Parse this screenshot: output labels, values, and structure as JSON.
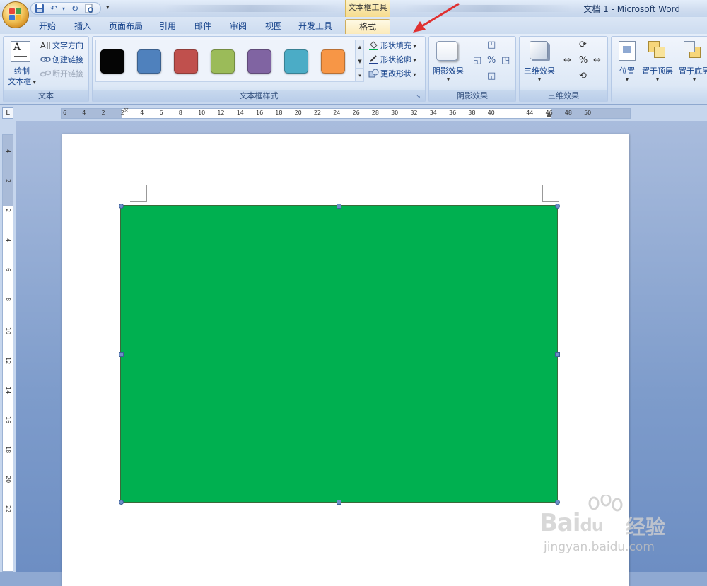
{
  "window": {
    "title": "文档 1 - Microsoft Word",
    "context_tool_title": "文本框工具"
  },
  "tabs": [
    {
      "label": "开始",
      "active": false
    },
    {
      "label": "插入",
      "active": false
    },
    {
      "label": "页面布局",
      "active": false
    },
    {
      "label": "引用",
      "active": false
    },
    {
      "label": "邮件",
      "active": false
    },
    {
      "label": "审阅",
      "active": false
    },
    {
      "label": "视图",
      "active": false
    },
    {
      "label": "开发工具",
      "active": false
    },
    {
      "label": "格式",
      "active": true
    }
  ],
  "ribbon": {
    "text_group": {
      "label": "文本",
      "draw_textbox_line1": "绘制",
      "draw_textbox_line2": "文本框",
      "text_direction": "文字方向",
      "create_link": "创建链接",
      "break_link": "断开链接"
    },
    "textbox_styles": {
      "label": "文本框样式",
      "swatches": [
        "#050505",
        "#4f81bd",
        "#c0504d",
        "#9bbb59",
        "#8064a2",
        "#4bacc6",
        "#f79646"
      ],
      "shape_fill": "形状填充",
      "shape_outline": "形状轮廓",
      "change_shape": "更改形状"
    },
    "shadow_effects": {
      "label": "阴影效果",
      "button": "阴影效果"
    },
    "effects_3d": {
      "label": "三维效果",
      "button": "三维效果"
    },
    "arrange": {
      "position": "位置",
      "bring_to_front": "置于顶层",
      "send_to_back": "置于底层"
    }
  },
  "ruler": {
    "horizontal_ticks": [
      "6",
      "4",
      "2",
      "2",
      "4",
      "6",
      "8",
      "10",
      "12",
      "14",
      "16",
      "18",
      "20",
      "22",
      "24",
      "26",
      "28",
      "30",
      "32",
      "34",
      "36",
      "38",
      "40",
      "44",
      "46",
      "48",
      "50"
    ],
    "vertical_ticks": [
      "4",
      "2",
      "2",
      "4",
      "6",
      "8",
      "10",
      "12",
      "14",
      "16",
      "18",
      "20",
      "22"
    ]
  },
  "document": {
    "shape_fill_color": "#00b050"
  },
  "watermark": {
    "brand": "Bai",
    "brand_du": "du",
    "cn": "经验",
    "url": "jingyan.baidu.com"
  }
}
